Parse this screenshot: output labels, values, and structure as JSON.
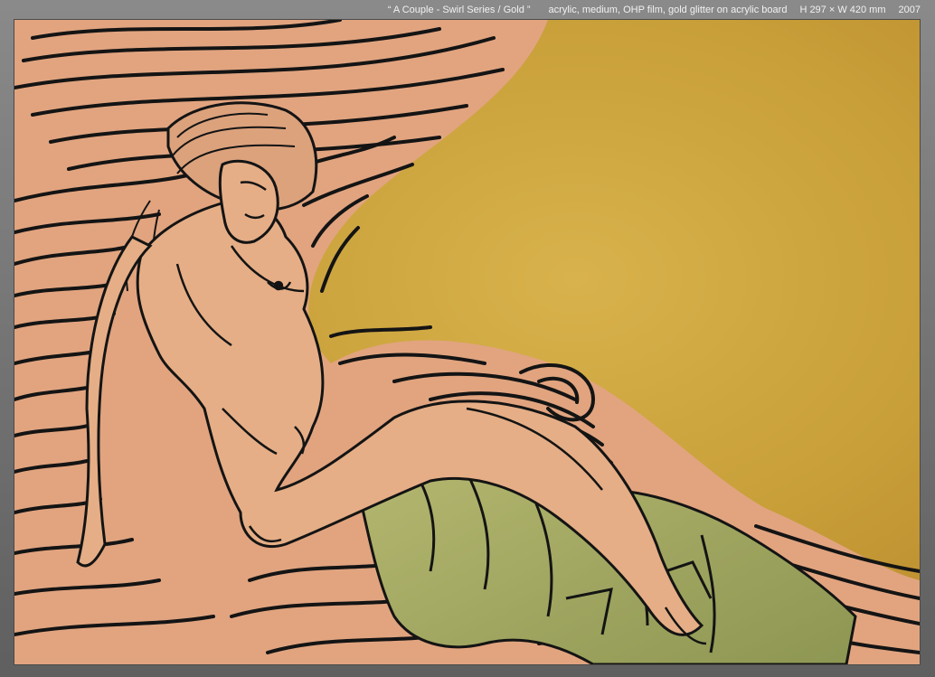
{
  "caption": {
    "title": "“ A Couple - Swirl Series / Gold ”",
    "medium": "acrylic, medium, OHP film, gold glitter on acrylic board",
    "dimensions": "H 297 × W 420 mm",
    "year": "2007"
  },
  "artwork": {
    "background_color": "#c89e3a",
    "pink_color": "#e4a982",
    "green_color": "#a7ab63",
    "line_color": "#141414"
  }
}
